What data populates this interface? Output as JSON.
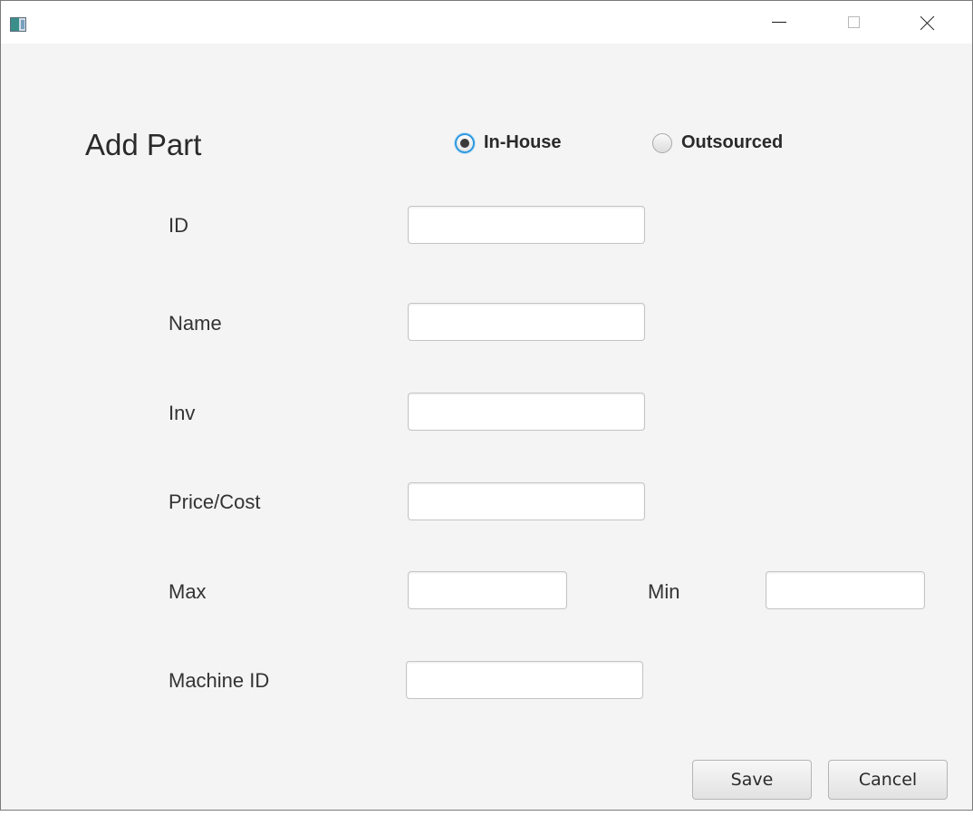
{
  "window": {
    "controls": {
      "minimize_icon": "minimize-icon",
      "maximize_icon": "maximize-icon",
      "close_icon": "close-icon"
    }
  },
  "form": {
    "title": "Add Part",
    "source_options": [
      {
        "label": "In-House",
        "selected": true
      },
      {
        "label": "Outsourced",
        "selected": false
      }
    ],
    "fields": {
      "id": {
        "label": "ID",
        "value": ""
      },
      "name": {
        "label": "Name",
        "value": ""
      },
      "inv": {
        "label": "Inv",
        "value": ""
      },
      "price_cost": {
        "label": "Price/Cost",
        "value": ""
      },
      "max": {
        "label": "Max",
        "value": ""
      },
      "min": {
        "label": "Min",
        "value": ""
      },
      "machine_id": {
        "label": "Machine ID",
        "value": ""
      }
    },
    "buttons": {
      "save": "Save",
      "cancel": "Cancel"
    }
  },
  "colors": {
    "accent": "#2c97de",
    "background": "#f4f4f4"
  }
}
